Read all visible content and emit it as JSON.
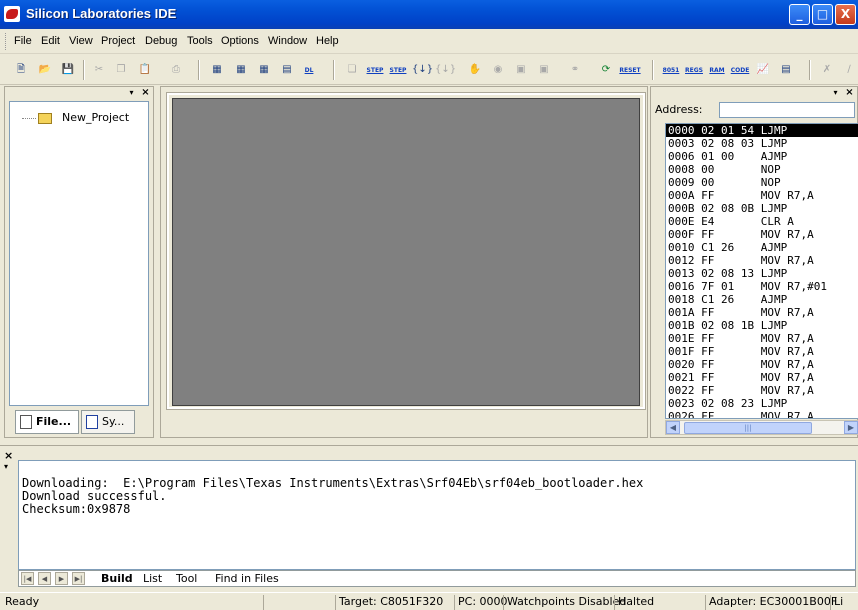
{
  "window": {
    "title": "Silicon Laboratories IDE",
    "buttons": {
      "minimize": "_",
      "maximize": "□",
      "close": "X"
    }
  },
  "menu": [
    "File",
    "Edit",
    "View",
    "Project",
    "Debug",
    "Tools",
    "Options",
    "Window",
    "Help"
  ],
  "toolbar": {
    "file_icons": [
      "new-file-icon",
      "open-folder-icon",
      "save-icon"
    ],
    "edit_icons": [
      "cut-icon",
      "copy-icon",
      "paste-icon",
      "print-icon"
    ],
    "build_labels": [
      "STEP",
      "STEP",
      "DL"
    ],
    "reset_label": "RESET",
    "window_labels": [
      "8051",
      "REGS",
      "RAM",
      "CODE"
    ]
  },
  "file_panel": {
    "project_name": "New_Project",
    "tabs": [
      "File...",
      "Sy..."
    ]
  },
  "disassembly": {
    "address_label": "Address:",
    "address_value": "",
    "rows": [
      "0000 02 01 54 LJMP",
      "0003 02 08 03 LJMP",
      "0006 01 00    AJMP",
      "0008 00       NOP",
      "0009 00       NOP",
      "000A FF       MOV R7,A",
      "000B 02 08 0B LJMP",
      "000E E4       CLR A",
      "000F FF       MOV R7,A",
      "0010 C1 26    AJMP",
      "0012 FF       MOV R7,A",
      "0013 02 08 13 LJMP",
      "0016 7F 01    MOV R7,#01",
      "0018 C1 26    AJMP",
      "001A FF       MOV R7,A",
      "001B 02 08 1B LJMP",
      "001E FF       MOV R7,A",
      "001F FF       MOV R7,A",
      "0020 FF       MOV R7,A",
      "0021 FF       MOV R7,A",
      "0022 FF       MOV R7,A",
      "0023 02 08 23 LJMP",
      "0026 FF       MOV R7,A"
    ],
    "scroll_thumb": "|||"
  },
  "output": {
    "lines": [
      "Downloading:  E:\\Program Files\\Texas Instruments\\Extras\\Srf04Eb\\srf04eb_bootloader.hex",
      "Download successful.",
      "Checksum:0x9878"
    ],
    "tabs": [
      "Build",
      "List",
      "Tool",
      "Find in Files"
    ]
  },
  "status": {
    "ready": "Ready",
    "target": "Target: C8051F320",
    "pc": "PC: 0000",
    "watchpoints": "Watchpoints Disabled",
    "state": "Halted",
    "adapter": "Adapter: EC30001B00F",
    "line": "Li"
  }
}
